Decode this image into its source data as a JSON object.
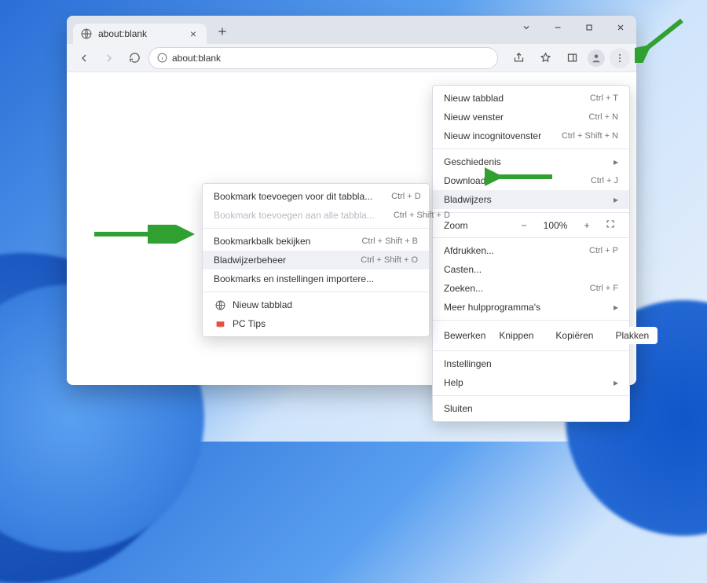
{
  "tab": {
    "title": "about:blank"
  },
  "omnibox": {
    "url": "about:blank"
  },
  "main_menu": {
    "new_tab": {
      "label": "Nieuw tabblad",
      "shortcut": "Ctrl + T"
    },
    "new_window": {
      "label": "Nieuw venster",
      "shortcut": "Ctrl + N"
    },
    "new_incognito": {
      "label": "Nieuw incognitovenster",
      "shortcut": "Ctrl + Shift + N"
    },
    "history": {
      "label": "Geschiedenis"
    },
    "downloads": {
      "label": "Downloads",
      "shortcut": "Ctrl + J"
    },
    "bookmarks": {
      "label": "Bladwijzers"
    },
    "zoom_label": "Zoom",
    "zoom_value": "100%",
    "print": {
      "label": "Afdrukken...",
      "shortcut": "Ctrl + P"
    },
    "cast": {
      "label": "Casten..."
    },
    "find": {
      "label": "Zoeken...",
      "shortcut": "Ctrl + F"
    },
    "more_tools": {
      "label": "Meer hulpprogramma's"
    },
    "edit_label": "Bewerken",
    "cut": "Knippen",
    "copy": "Kopiëren",
    "paste": "Plakken",
    "settings": {
      "label": "Instellingen"
    },
    "help": {
      "label": "Help"
    },
    "exit": {
      "label": "Sluiten"
    }
  },
  "bookmarks_menu": {
    "add_this": {
      "label": "Bookmark toevoegen voor dit tabbla...",
      "shortcut": "Ctrl + D"
    },
    "add_all": {
      "label": "Bookmark toevoegen aan alle tabbla...",
      "shortcut": "Ctrl + Shift + D"
    },
    "show_bar": {
      "label": "Bookmarkbalk bekijken",
      "shortcut": "Ctrl + Shift + B"
    },
    "manager": {
      "label": "Bladwijzerbeheer",
      "shortcut": "Ctrl + Shift + O"
    },
    "import": {
      "label": "Bookmarks en instellingen importere..."
    },
    "item_new_tab": "Nieuw tabblad",
    "item_pctips": "PC Tips"
  }
}
